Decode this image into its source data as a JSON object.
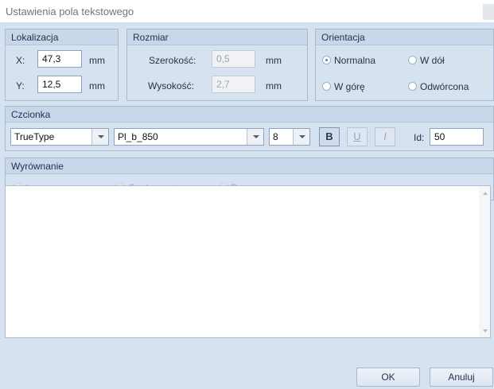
{
  "window": {
    "title": "Ustawienia pola tekstowego"
  },
  "location": {
    "header": "Lokalizacja",
    "x_label": "X:",
    "x_value": "47,3",
    "x_unit": "mm",
    "y_label": "Y:",
    "y_value": "12,5",
    "y_unit": "mm"
  },
  "size": {
    "header": "Rozmiar",
    "width_label": "Szerokość:",
    "width_value": "0,5",
    "width_unit": "mm",
    "height_label": "Wysokość:",
    "height_value": "2,7",
    "height_unit": "mm"
  },
  "orientation": {
    "header": "Orientacja",
    "normal": "Normalna",
    "down": "W dół",
    "up": "W górę",
    "reversed": "Odwórcona",
    "selected": "Normalna"
  },
  "font": {
    "header": "Czcionka",
    "type": "TrueType",
    "name": "Pl_b_850",
    "size": "8",
    "bold_label": "B",
    "underline_label": "U",
    "italic_label": "I",
    "id_label": "Id:",
    "id_value": "50"
  },
  "alignment": {
    "header": "Wyrównanie",
    "left": "Lewo",
    "center": "Centrowanie",
    "right": "Prawo"
  },
  "buttons": {
    "ok": "OK",
    "cancel": "Anuluj"
  },
  "colors": {
    "dialog_bg": "#d7e2f0",
    "group_header_bg": "#c9d7ea",
    "border": "#a9b9ce"
  },
  "icons": [
    "combo-arrow-icon",
    "scroll-up-arrow-icon",
    "scroll-down-arrow-icon",
    "radio-icon"
  ]
}
